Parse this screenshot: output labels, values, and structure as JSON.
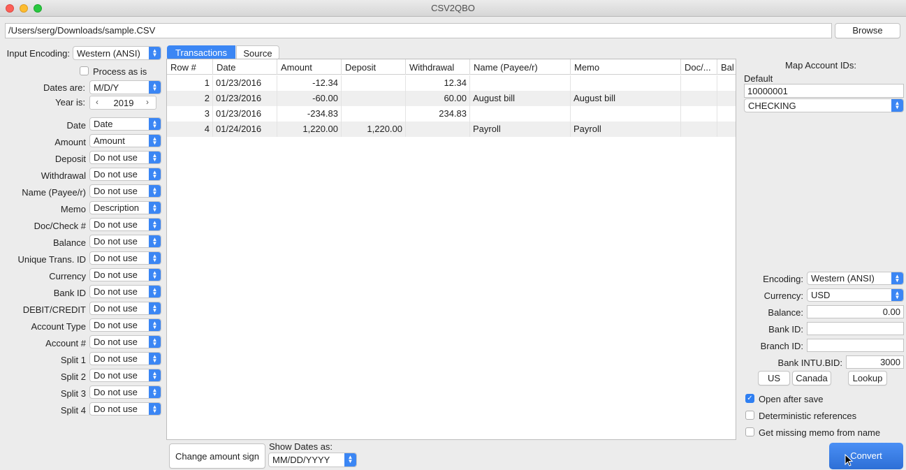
{
  "window": {
    "title": "CSV2QBO"
  },
  "path": {
    "value": "/Users/serg/Downloads/sample.CSV",
    "browse_label": "Browse"
  },
  "left": {
    "input_encoding_label": "Input Encoding:",
    "input_encoding_value": "Western (ANSI)",
    "process_as_is_label": "Process as is",
    "dates_are_label": "Dates are:",
    "dates_are_value": "M/D/Y",
    "year_is_label": "Year is:",
    "year_value": "2019",
    "mappings": [
      {
        "label": "Date",
        "value": "Date"
      },
      {
        "label": "Amount",
        "value": "Amount"
      },
      {
        "label": "Deposit",
        "value": "Do not use"
      },
      {
        "label": "Withdrawal",
        "value": "Do not use"
      },
      {
        "label": "Name (Payee/r)",
        "value": "Do not use"
      },
      {
        "label": "Memo",
        "value": "Description"
      },
      {
        "label": "Doc/Check #",
        "value": "Do not use"
      },
      {
        "label": "Balance",
        "value": "Do not use"
      },
      {
        "label": "Unique Trans. ID",
        "value": "Do not use"
      },
      {
        "label": "Currency",
        "value": "Do not use"
      },
      {
        "label": "Bank ID",
        "value": "Do not use"
      },
      {
        "label": "DEBIT/CREDIT",
        "value": "Do not use"
      },
      {
        "label": "Account Type",
        "value": "Do not use"
      },
      {
        "label": "Account #",
        "value": "Do not use"
      },
      {
        "label": "Split 1",
        "value": "Do not use"
      },
      {
        "label": "Split 2",
        "value": "Do not use"
      },
      {
        "label": "Split 3",
        "value": "Do not use"
      },
      {
        "label": "Split 4",
        "value": "Do not use"
      }
    ]
  },
  "tabs": [
    {
      "label": "Transactions"
    },
    {
      "label": "Source"
    }
  ],
  "table": {
    "columns": [
      "Row #",
      "Date",
      "Amount",
      "Deposit",
      "Withdrawal",
      "Name (Payee/r)",
      "Memo",
      "Doc/...",
      "Bal"
    ],
    "rows": [
      [
        "1",
        "01/23/2016",
        "-12.34",
        "",
        "12.34",
        "",
        "",
        "",
        ""
      ],
      [
        "2",
        "01/23/2016",
        "-60.00",
        "",
        "60.00",
        "August bill",
        "August bill",
        "",
        ""
      ],
      [
        "3",
        "01/23/2016",
        "-234.83",
        "",
        "234.83",
        "",
        "",
        "",
        ""
      ],
      [
        "4",
        "01/24/2016",
        "1,220.00",
        "1,220.00",
        "",
        "Payroll",
        "Payroll",
        "",
        ""
      ]
    ]
  },
  "bottom": {
    "change_sign_label": "Change amount sign",
    "show_dates_label": "Show Dates as:",
    "show_dates_value": "MM/DD/YYYY"
  },
  "right": {
    "map_account_title": "Map Account IDs:",
    "default_label": "Default",
    "account_id_value": "10000001",
    "account_type_value": "CHECKING",
    "encoding_label": "Encoding:",
    "encoding_value": "Western (ANSI)",
    "currency_label": "Currency:",
    "currency_value": "USD",
    "balance_label": "Balance:",
    "balance_value": "0.00",
    "bank_id_label": "Bank ID:",
    "branch_id_label": "Branch ID:",
    "intu_bid_label": "Bank INTU.BID:",
    "intu_bid_value": "3000",
    "us_label": "US",
    "canada_label": "Canada",
    "lookup_label": "Lookup",
    "open_after_save_label": "Open after save",
    "deterministic_label": "Deterministic references",
    "missing_memo_label": "Get missing memo from name",
    "convert_label": "Convert"
  },
  "colors": {
    "accent": "#3b86f4",
    "convert": "#2d6fd6"
  }
}
